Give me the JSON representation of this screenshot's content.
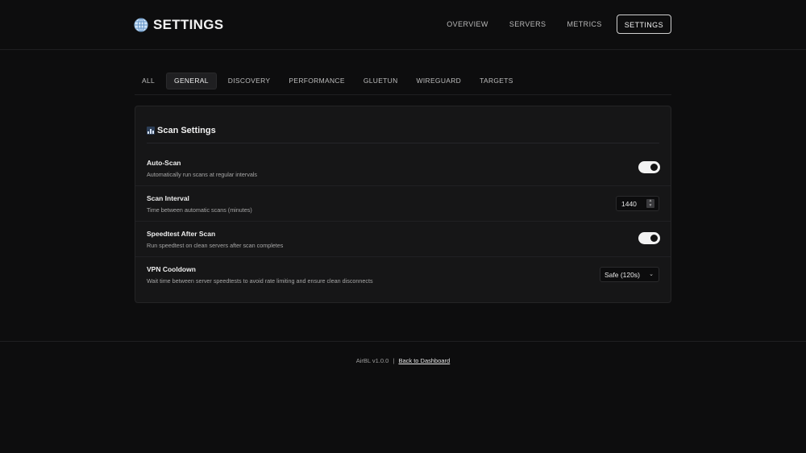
{
  "header": {
    "title": "SETTINGS",
    "nav": [
      "OVERVIEW",
      "SERVERS",
      "METRICS",
      "SETTINGS"
    ],
    "active_nav": "SETTINGS"
  },
  "tabs": {
    "items": [
      "ALL",
      "GENERAL",
      "DISCOVERY",
      "PERFORMANCE",
      "GLUETUN",
      "WIREGUARD",
      "TARGETS"
    ],
    "active": "GENERAL"
  },
  "card": {
    "title": "Scan Settings",
    "icon": "bar-chart-icon",
    "rows": [
      {
        "label": "Auto-Scan",
        "desc": "Automatically run scans at regular intervals",
        "control": "toggle",
        "value": true
      },
      {
        "label": "Scan Interval",
        "desc": "Time between automatic scans (minutes)",
        "control": "number",
        "value": "1440"
      },
      {
        "label": "Speedtest After Scan",
        "desc": "Run speedtest on clean servers after scan completes",
        "control": "toggle",
        "value": true
      },
      {
        "label": "VPN Cooldown",
        "desc": "Wait time between server speedtests to avoid rate limiting and ensure clean disconnects",
        "control": "select",
        "value": "Safe (120s)"
      }
    ]
  },
  "footer": {
    "version": "AirBL v1.0.0",
    "separator": "|",
    "link": "Back to Dashboard"
  },
  "colors": {
    "background": "#0d0d0e",
    "card": "#161617",
    "text": "#e6e6e6",
    "muted": "#a6a6a6",
    "toggle_on": "#f2f2f2"
  }
}
